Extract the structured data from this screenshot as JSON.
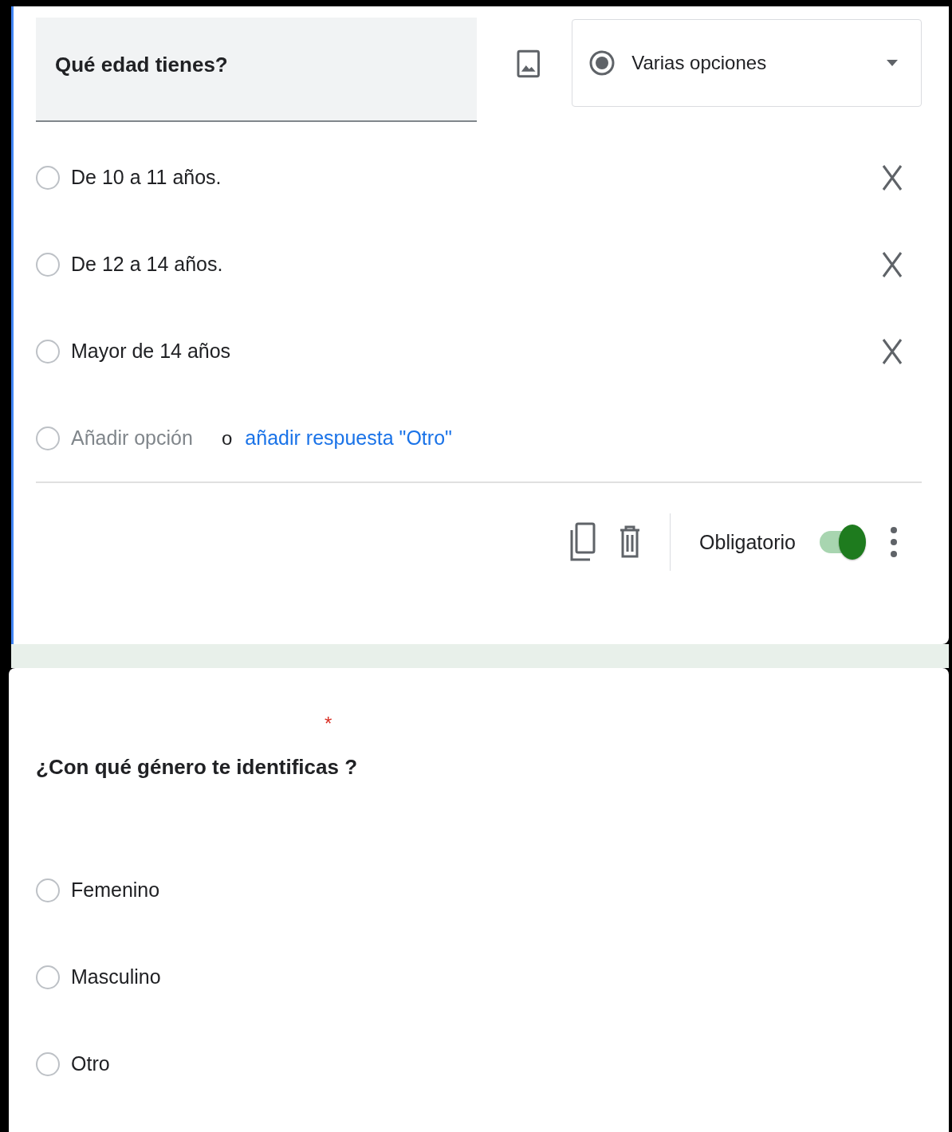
{
  "question_1": {
    "title": "Qué edad tienes?",
    "question_type": "Varias opciones",
    "options": [
      {
        "label": "De 10 a 11 años.",
        "selected": false
      },
      {
        "label": "De 12 a 14 años.",
        "selected": false
      },
      {
        "label": "Mayor de 14 años",
        "selected": false
      }
    ],
    "add_option": {
      "placeholder": "Añadir opción",
      "separator": "o",
      "other_link": "añadir respuesta \"Otro\"",
      "selected": false
    },
    "required_label": "Obligatorio",
    "required": true
  },
  "question_2": {
    "title": "¿Con qué género te identificas ?",
    "required_mark": "*",
    "options": [
      {
        "label": "Femenino",
        "selected": false
      },
      {
        "label": "Masculino",
        "selected": false
      },
      {
        "label": "Otro",
        "selected": false
      }
    ]
  }
}
